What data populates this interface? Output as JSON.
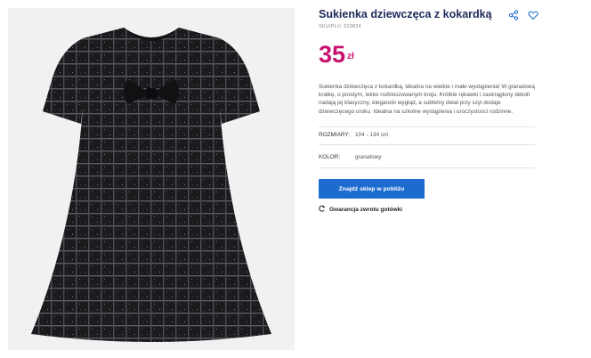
{
  "product": {
    "title": "Sukienka dziewczęca z kokardką",
    "sku": "SKU/PLU: 623824",
    "price": "35",
    "currency": "zł",
    "description": "Sukienka dziewczęca z kokardką, idealna na wielkie i małe wystąpienia! W granatową kratkę, o prostym, lekko rozkloszowanym kroju. Krótkie rękawki i zaokrąglony dekolt nadają jej klasyczny, elegancki wygląd, a subtelny detal przy szyi dodaje dziewczęcego uroku. Idealna na szkolne wystąpienia i uroczystości rodzinne.",
    "image_icon": "dress-photo"
  },
  "attributes": {
    "sizes_label": "ROZMIARY:",
    "sizes_value": "104 - 134 cm",
    "color_label": "KOLOR:",
    "color_value": "granatowy"
  },
  "actions": {
    "share_icon": "share-icon",
    "wishlist_icon": "heart-icon",
    "store_button": "Znajdź sklep w pobliżu",
    "guarantee_label": "Gwarancja zwrotu gotówki",
    "guarantee_icon": "refresh-icon"
  },
  "colors": {
    "title": "#1f2a5a",
    "price": "#c8116e",
    "button": "#1c6cd0",
    "icon_accent": "#1c6cd0"
  }
}
